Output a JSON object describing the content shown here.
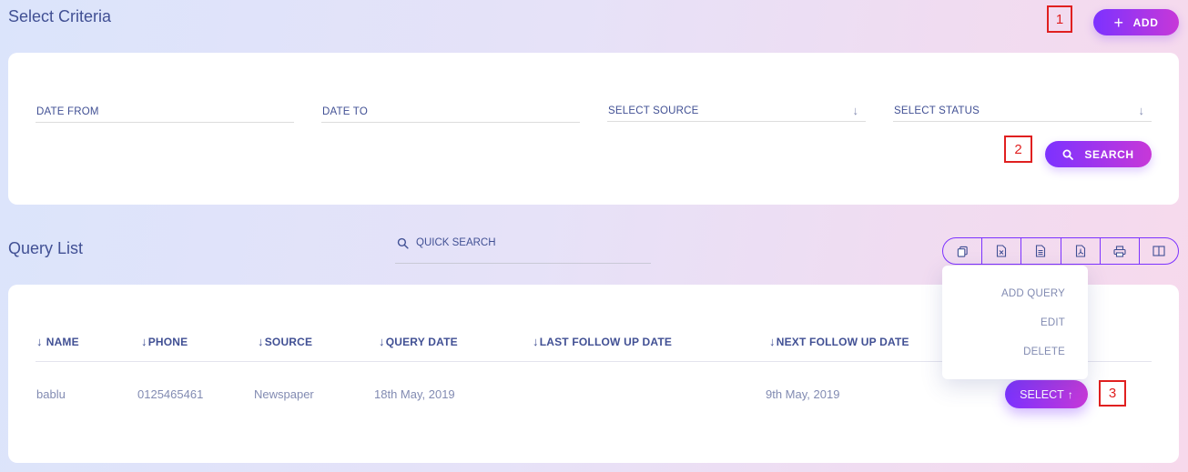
{
  "header": {
    "title": "Select Criteria",
    "add_label": "ADD",
    "marker_1": "1"
  },
  "criteria": {
    "date_from": "DATE FROM",
    "date_to": "DATE TO",
    "select_source": "SELECT SOURCE",
    "select_status": "SELECT STATUS",
    "search_label": "SEARCH",
    "marker_2": "2"
  },
  "query_list": {
    "title": "Query List",
    "quick_search_placeholder": "QUICK SEARCH",
    "toolbar_icons": [
      "copy-icon",
      "excel-icon",
      "csv-icon",
      "pdf-icon",
      "print-icon",
      "columns-icon"
    ],
    "columns": [
      "NAME",
      "PHONE",
      "SOURCE",
      "QUERY DATE",
      "LAST FOLLOW UP DATE",
      "NEXT FOLLOW UP DATE"
    ],
    "rows": [
      {
        "name": "bablu",
        "phone": "0125465461",
        "source": "Newspaper",
        "query_date": "18th May, 2019",
        "last_follow_up_date": "",
        "next_follow_up_date": "9th May, 2019",
        "action_label": "SELECT"
      }
    ],
    "dropdown": [
      "ADD QUERY",
      "EDIT",
      "DELETE"
    ],
    "marker_3": "3"
  },
  "colors": {
    "accent_start": "#7c32ff",
    "accent_end": "#c738d8",
    "text_primary": "#415094",
    "text_muted": "#828bb2",
    "marker": "#e02020"
  }
}
